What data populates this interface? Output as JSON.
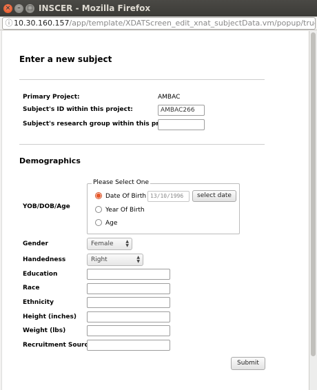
{
  "window": {
    "title": "INSCER - Mozilla Firefox",
    "close_glyph": "×",
    "min_glyph": "–",
    "max_glyph": "□"
  },
  "urlbar": {
    "host": "10.30.160.157",
    "path": "/app/template/XDATScreen_edit_xnat_subjectData.vm/popup/true/prc"
  },
  "form": {
    "heading": "Enter a new subject",
    "primary_project_label": "Primary Project:",
    "primary_project_value": "AMBAC",
    "subject_id_label": "Subject's ID within this project:",
    "subject_id_value": "AMBAC266",
    "research_group_label": "Subject's research group within this project:",
    "research_group_value": ""
  },
  "demographics": {
    "heading": "Demographics",
    "yob_label": "YOB/DOB/Age",
    "legend": "Please Select One",
    "options": [
      "Date Of Birth",
      "Year Of Birth",
      "Age"
    ],
    "selected_option": "Date Of Birth",
    "date_value": "13/10/1996",
    "select_date_label": "select date",
    "gender_label": "Gender",
    "gender_value": "Female",
    "handedness_label": "Handedness",
    "handedness_value": "Right",
    "education_label": "Education",
    "race_label": "Race",
    "ethnicity_label": "Ethnicity",
    "height_label": "Height (inches)",
    "weight_label": "Weight (lbs)",
    "recruitment_label": "Recruitment Source",
    "education_value": "",
    "race_value": "",
    "ethnicity_value": "",
    "height_value": "",
    "weight_value": "",
    "recruitment_value": ""
  },
  "submit_label": "Submit",
  "colors": {
    "titlebar": "#3c3b37",
    "close_button": "#e95420",
    "radio_selected": "#e8582a"
  }
}
